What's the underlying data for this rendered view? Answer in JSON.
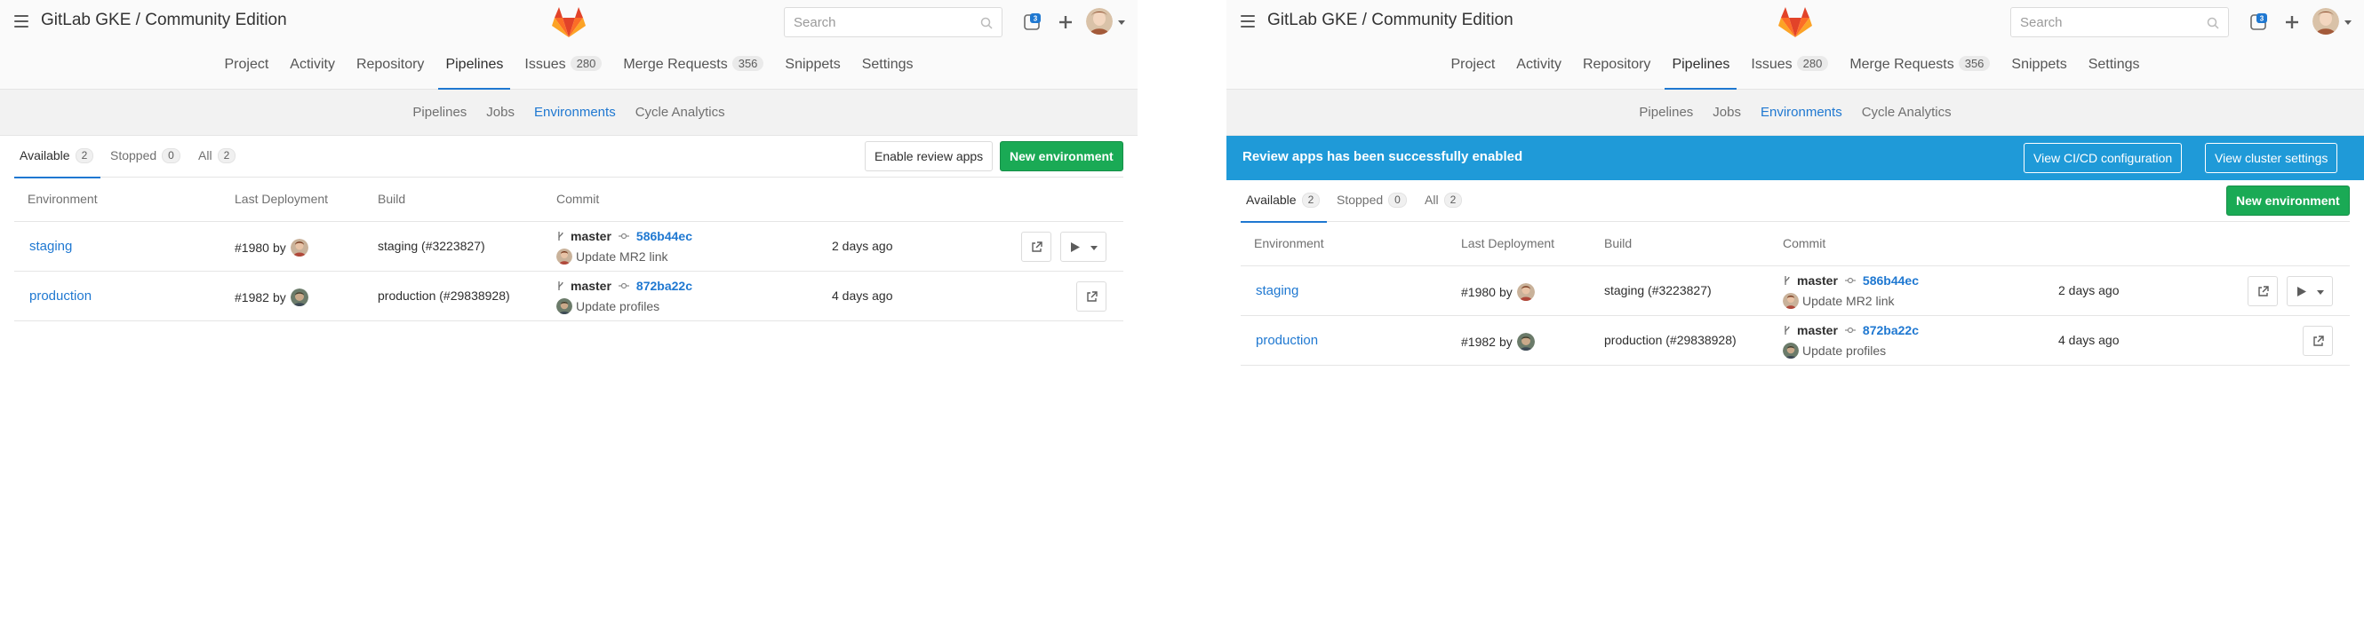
{
  "app": {
    "title": "GitLab GKE / Community Edition"
  },
  "search": {
    "placeholder": "Search"
  },
  "nav": {
    "items": [
      {
        "label": "Project"
      },
      {
        "label": "Activity"
      },
      {
        "label": "Repository"
      },
      {
        "label": "Pipelines",
        "active": true
      },
      {
        "label": "Issues",
        "count": "280"
      },
      {
        "label": "Merge Requests",
        "count": "356"
      },
      {
        "label": "Snippets"
      },
      {
        "label": "Settings"
      }
    ]
  },
  "subnav": {
    "items": [
      {
        "label": "Pipelines"
      },
      {
        "label": "Jobs"
      },
      {
        "label": "Environments",
        "active": true
      },
      {
        "label": "Cycle Analytics"
      }
    ]
  },
  "scopes": {
    "available": {
      "label": "Available",
      "count": "2"
    },
    "stopped": {
      "label": "Stopped",
      "count": "0"
    },
    "all": {
      "label": "All",
      "count": "2"
    }
  },
  "buttons": {
    "enable_review_apps": "Enable review apps",
    "new_environment": "New environment"
  },
  "flash": {
    "message": "Review apps has been successfully enabled",
    "cicd_button": "View CI/CD configuration",
    "cluster_button": "View cluster settings"
  },
  "table": {
    "headers": {
      "environment": "Environment",
      "last_deployment": "Last Deployment",
      "build": "Build",
      "commit": "Commit"
    },
    "by_label": "by",
    "rows": [
      {
        "environment": "staging",
        "deployment": "#1980",
        "build": "staging (#3223827)",
        "ref": "master",
        "sha": "586b44ec",
        "commit_title": "Update MR2 link",
        "ago": "2 days ago",
        "has_play": true
      },
      {
        "environment": "production",
        "deployment": "#1982",
        "build": "production (#29838928)",
        "ref": "master",
        "sha": "872ba22c",
        "commit_title": "Update profiles",
        "ago": "4 days ago",
        "has_play": false
      }
    ]
  },
  "icons": {
    "menu": "hamburger-icon",
    "logo": "gitlab-tanuki-logo",
    "search": "search-icon",
    "todos": "todos-icon",
    "new": "plus-icon",
    "external": "external-link-icon",
    "play": "play-icon",
    "branch": "branch-icon",
    "commit": "commit-icon"
  },
  "colors": {
    "link": "#1f78d1",
    "success": "#1aaa55",
    "flash": "#1f9ad8",
    "logo_orange": "#e24329",
    "logo_light": "#fca326"
  }
}
